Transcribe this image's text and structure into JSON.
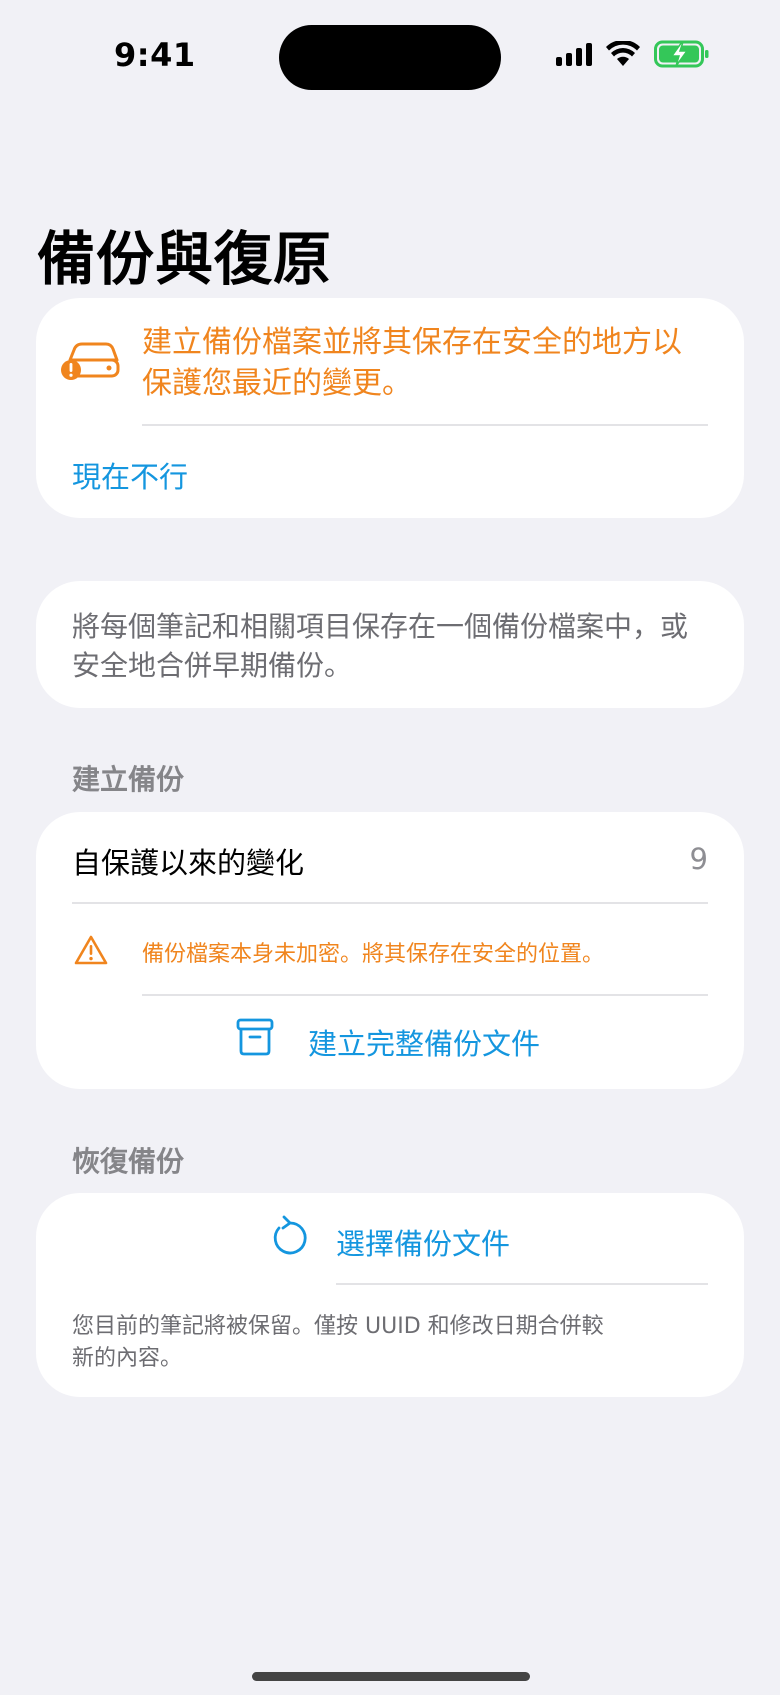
{
  "status_bar": {
    "time": "9:41",
    "battery_color": "#34C759"
  },
  "page_title": "備份與復原",
  "backup_warning": {
    "icon": "drive-warning-icon",
    "message": "建立備份檔案並將其保存在安全的地方以保護您最近的變更。",
    "dismiss_label": "現在不行",
    "color": "#F0851E"
  },
  "info": {
    "text": "將每個筆記和相關項目保存在一個備份檔案中，或安全地合併早期備份。"
  },
  "create_section": {
    "header": "建立備份",
    "changes_label": "自保護以來的變化",
    "changes_count": "9",
    "encryption_note": "備份檔案本身未加密。將其保存在安全的位置。",
    "create_button_label": "建立完整備份文件"
  },
  "restore_section": {
    "header": "恢復備份",
    "choose_button_label": "選擇備份文件",
    "note": "您目前的筆記將被保留。僅按 UUID 和修改日期合併較新的內容。"
  },
  "accent_color": "#1496DF"
}
